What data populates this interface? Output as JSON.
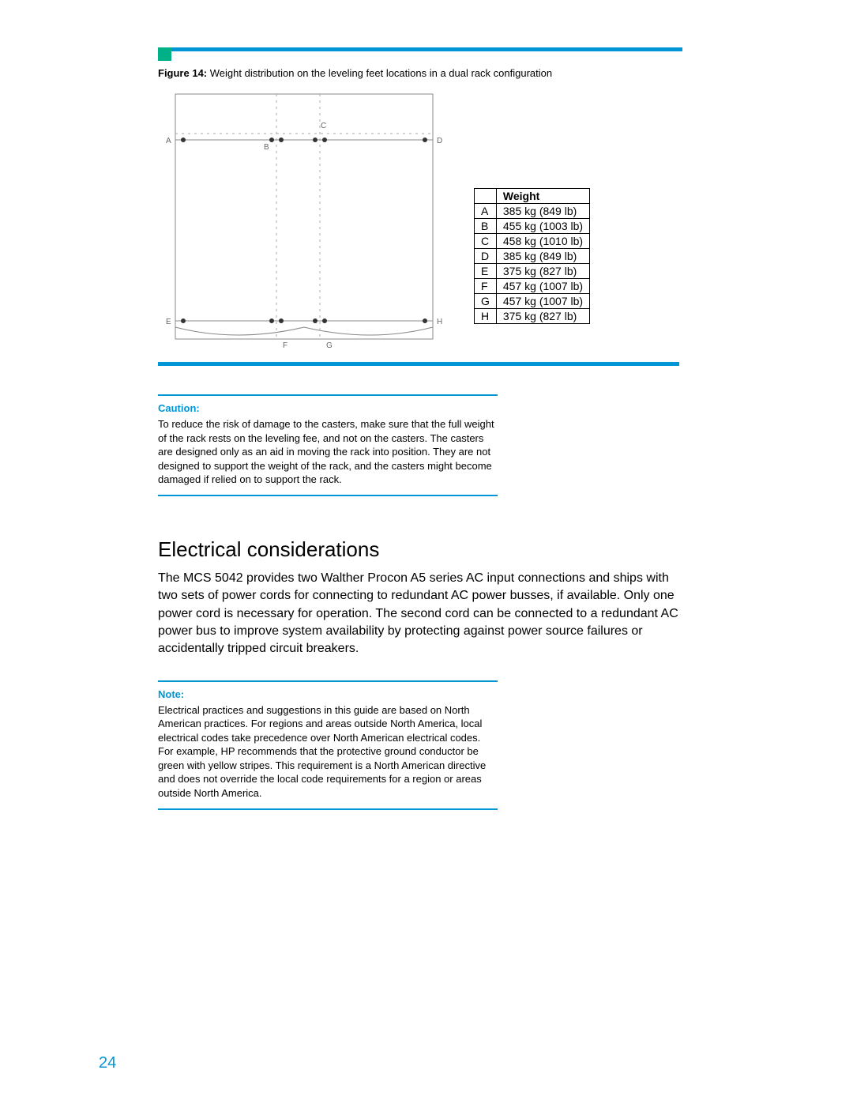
{
  "figure": {
    "label": "Figure 14:",
    "caption": "Weight distribution on the leveling feet locations in a dual rack configuration"
  },
  "diagram_labels": {
    "A": "A",
    "B": "B",
    "C": "C",
    "D": "D",
    "E": "E",
    "F": "F",
    "G": "G",
    "H": "H"
  },
  "weight_table": {
    "header": "Weight",
    "rows": [
      {
        "k": "A",
        "v": "385 kg (849 lb)"
      },
      {
        "k": "B",
        "v": "455 kg (1003 lb)"
      },
      {
        "k": "C",
        "v": "458 kg (1010 lb)"
      },
      {
        "k": "D",
        "v": "385 kg (849 lb)"
      },
      {
        "k": "E",
        "v": "375  kg (827 lb)"
      },
      {
        "k": "F",
        "v": "457  kg (1007 lb)"
      },
      {
        "k": "G",
        "v": "457  kg (1007 lb)"
      },
      {
        "k": "H",
        "v": "375 kg (827 lb)"
      }
    ]
  },
  "caution": {
    "label": "Caution:",
    "body": "To reduce the risk of damage to the casters, make sure that the full weight of the rack rests on the leveling fee, and not on the casters. The casters are designed only as an aid in moving the rack into position. They are not designed to support the weight of the rack, and the casters might become damaged if relied on to support the rack."
  },
  "section": {
    "heading": "Electrical considerations",
    "body": "The MCS 5042 provides two Walther Procon A5 series AC input connections and ships with two sets of power cords for connecting to redundant AC power busses, if available. Only one power cord is necessary for operation. The second cord can be connected to a redundant AC power bus to improve system availability by protecting against power source failures or accidentally tripped circuit breakers."
  },
  "note": {
    "label": "Note:",
    "body": "Electrical practices and suggestions in this guide are based on North American practices. For regions and areas outside North America, local electrical codes take precedence over North American electrical codes. For example, HP recommends that the protective ground conductor be green with yellow stripes. This requirement is a North American directive and does not override the local code requirements for a region or areas outside North America."
  },
  "page_number": "24"
}
